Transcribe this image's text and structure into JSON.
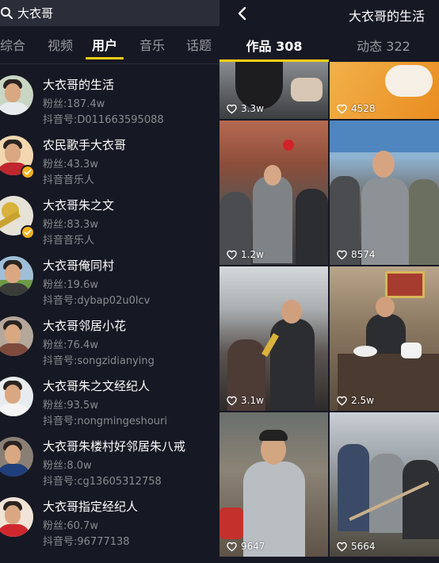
{
  "search": {
    "query": "大衣哥"
  },
  "tabs": [
    "综合",
    "视频",
    "用户",
    "音乐",
    "话题"
  ],
  "active_tab_index": 2,
  "users": [
    {
      "name": "大衣哥的生活",
      "fans": "粉丝:187.4w",
      "id": "抖音号:D011663595088",
      "verified": false
    },
    {
      "name": "农民歌手大衣哥",
      "fans": "粉丝:43.3w",
      "id": "抖音音乐人",
      "verified": true
    },
    {
      "name": "大衣哥朱之文",
      "fans": "粉丝:83.3w",
      "id": "抖音音乐人",
      "verified": true
    },
    {
      "name": "大衣哥俺同村",
      "fans": "粉丝:19.6w",
      "id": "抖音号:dybap02u0lcv",
      "verified": false
    },
    {
      "name": "大衣哥邻居小花",
      "fans": "粉丝:76.4w",
      "id": "抖音号:songzidianying",
      "verified": false
    },
    {
      "name": "大衣哥朱之文经纪人",
      "fans": "粉丝:93.5w",
      "id": "抖音号:nongmingeshouri",
      "verified": false
    },
    {
      "name": "大衣哥朱楼村好邻居朱八戒",
      "fans": "粉丝:8.0w",
      "id": "抖音号:cg13605312758",
      "verified": false
    },
    {
      "name": "大衣哥指定经纪人",
      "fans": "粉丝:60.7w",
      "id": "抖音号:96777138",
      "verified": false
    }
  ],
  "profile": {
    "title": "大衣哥的生活",
    "tab_works": "作品 308",
    "tab_moments": "动态 322"
  },
  "videos": [
    {
      "likes": "3.3w"
    },
    {
      "likes": "4528"
    },
    {
      "likes": "1.2w"
    },
    {
      "likes": "8574"
    },
    {
      "likes": "3.1w"
    },
    {
      "likes": "2.5w"
    },
    {
      "likes": "9647"
    },
    {
      "likes": "5664"
    }
  ],
  "colors": {
    "background": "#161823",
    "search_bg": "#2b2d39",
    "accent": "#face15",
    "verified_badge": "#f6b21d",
    "secondary_text": "#8a8b91"
  }
}
